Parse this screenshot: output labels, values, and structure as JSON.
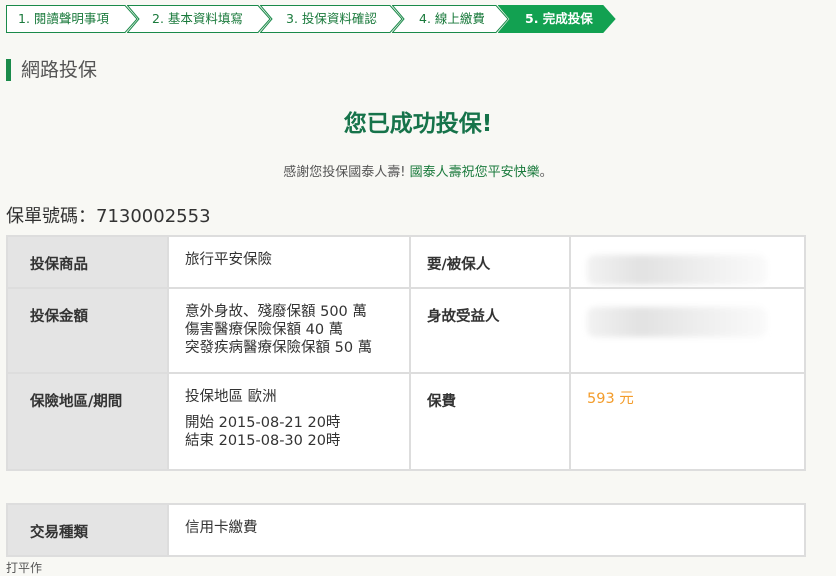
{
  "steps": [
    {
      "label": "1. 閱讀聲明事項",
      "active": false
    },
    {
      "label": "2. 基本資料填寫",
      "active": false
    },
    {
      "label": "3. 投保資料確認",
      "active": false
    },
    {
      "label": "4. 線上繳費",
      "active": false
    },
    {
      "label": "5. 完成投保",
      "active": true
    }
  ],
  "section_title": "網路投保",
  "success_message": "您已成功投保!",
  "thanks": {
    "prefix": "感謝您投保國泰人壽!",
    "highlight": "國泰人壽祝您平安快樂",
    "suffix": "。"
  },
  "policy": {
    "label": "保單號碼：",
    "number": "7130002553"
  },
  "details": {
    "product_label": "投保商品",
    "product_value": "旅行平安保險",
    "insured_label": "要/被保人",
    "amount_label": "投保金額",
    "amount_lines": [
      "意外身故、殘廢保額 500 萬",
      "傷害醫療保險保額 40 萬",
      "突發疾病醫療保險保額 50 萬"
    ],
    "beneficiary_label": "身故受益人",
    "region_label": "保險地區/期間",
    "region_value": "投保地區 歐洲",
    "start": "開始 2015-08-21 20時",
    "end": "結束 2015-08-30 20時",
    "premium_label": "保費",
    "premium_value": "593 元"
  },
  "transaction": {
    "label": "交易種類",
    "value": "信用卡繳費"
  },
  "cut_text": "打平作"
}
